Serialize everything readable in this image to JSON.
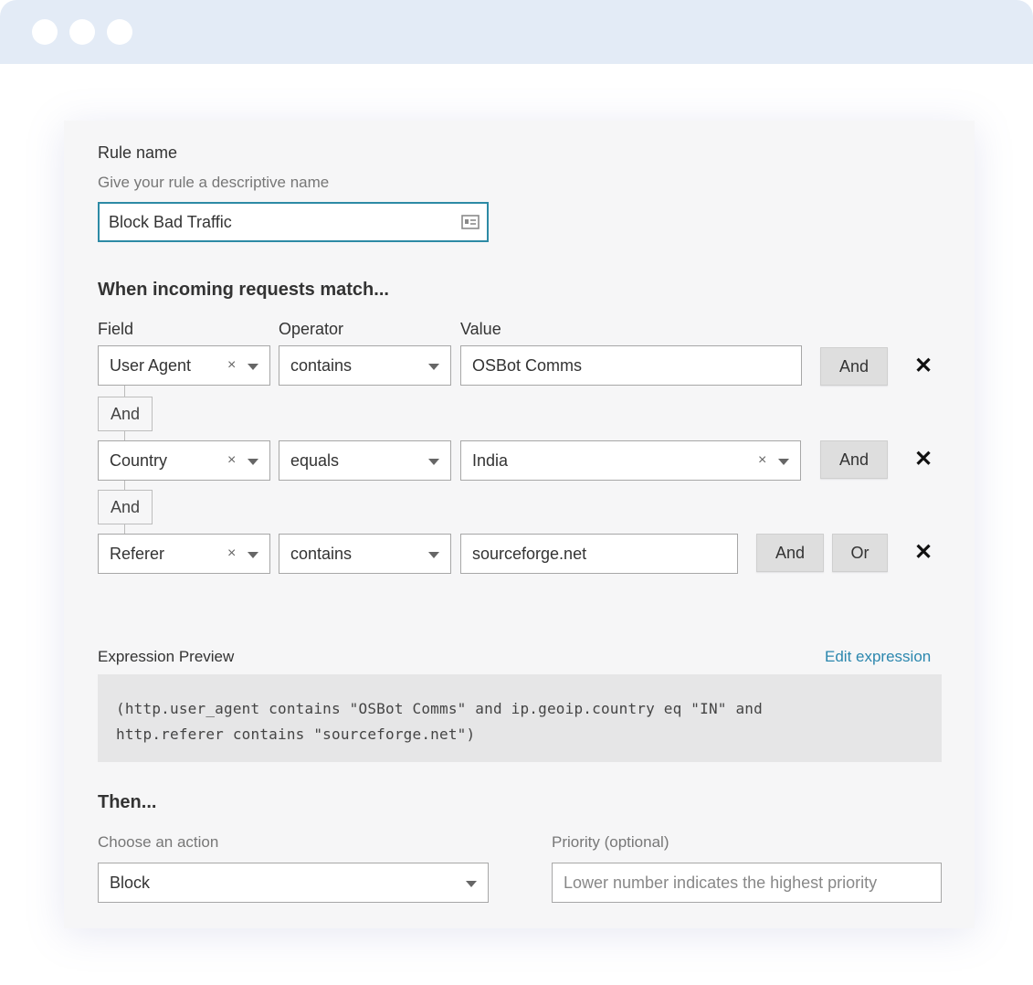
{
  "rule_name": {
    "label": "Rule name",
    "help": "Give your rule a descriptive name",
    "value": "Block Bad Traffic"
  },
  "match": {
    "heading": "When incoming requests match...",
    "columns": {
      "field": "Field",
      "operator": "Operator",
      "value": "Value"
    },
    "rows": [
      {
        "field": "User Agent",
        "operator": "contains",
        "value": "OSBot Comms",
        "and_label": "And"
      },
      {
        "field": "Country",
        "operator": "equals",
        "value": "India",
        "and_label": "And"
      },
      {
        "field": "Referer",
        "operator": "contains",
        "value": "sourceforge.net",
        "and_label": "And",
        "or_label": "Or"
      }
    ],
    "connectors": [
      "And",
      "And"
    ]
  },
  "expression": {
    "label": "Expression Preview",
    "edit_link": "Edit expression",
    "line1": "(http.user_agent contains \"OSBot Comms\" and ip.geoip.country eq \"IN\" and",
    "line2": "http.referer contains \"sourceforge.net\")"
  },
  "then": {
    "heading": "Then...",
    "action_label": "Choose an action",
    "action_value": "Block",
    "priority_label": "Priority (optional)",
    "priority_placeholder": "Lower number indicates the highest priority"
  },
  "icons": {
    "clear": "×",
    "remove": "✕"
  },
  "colors": {
    "titlebar": "#e3ebf6",
    "focus_border": "#2d8aa5",
    "link": "#2b87ae"
  }
}
